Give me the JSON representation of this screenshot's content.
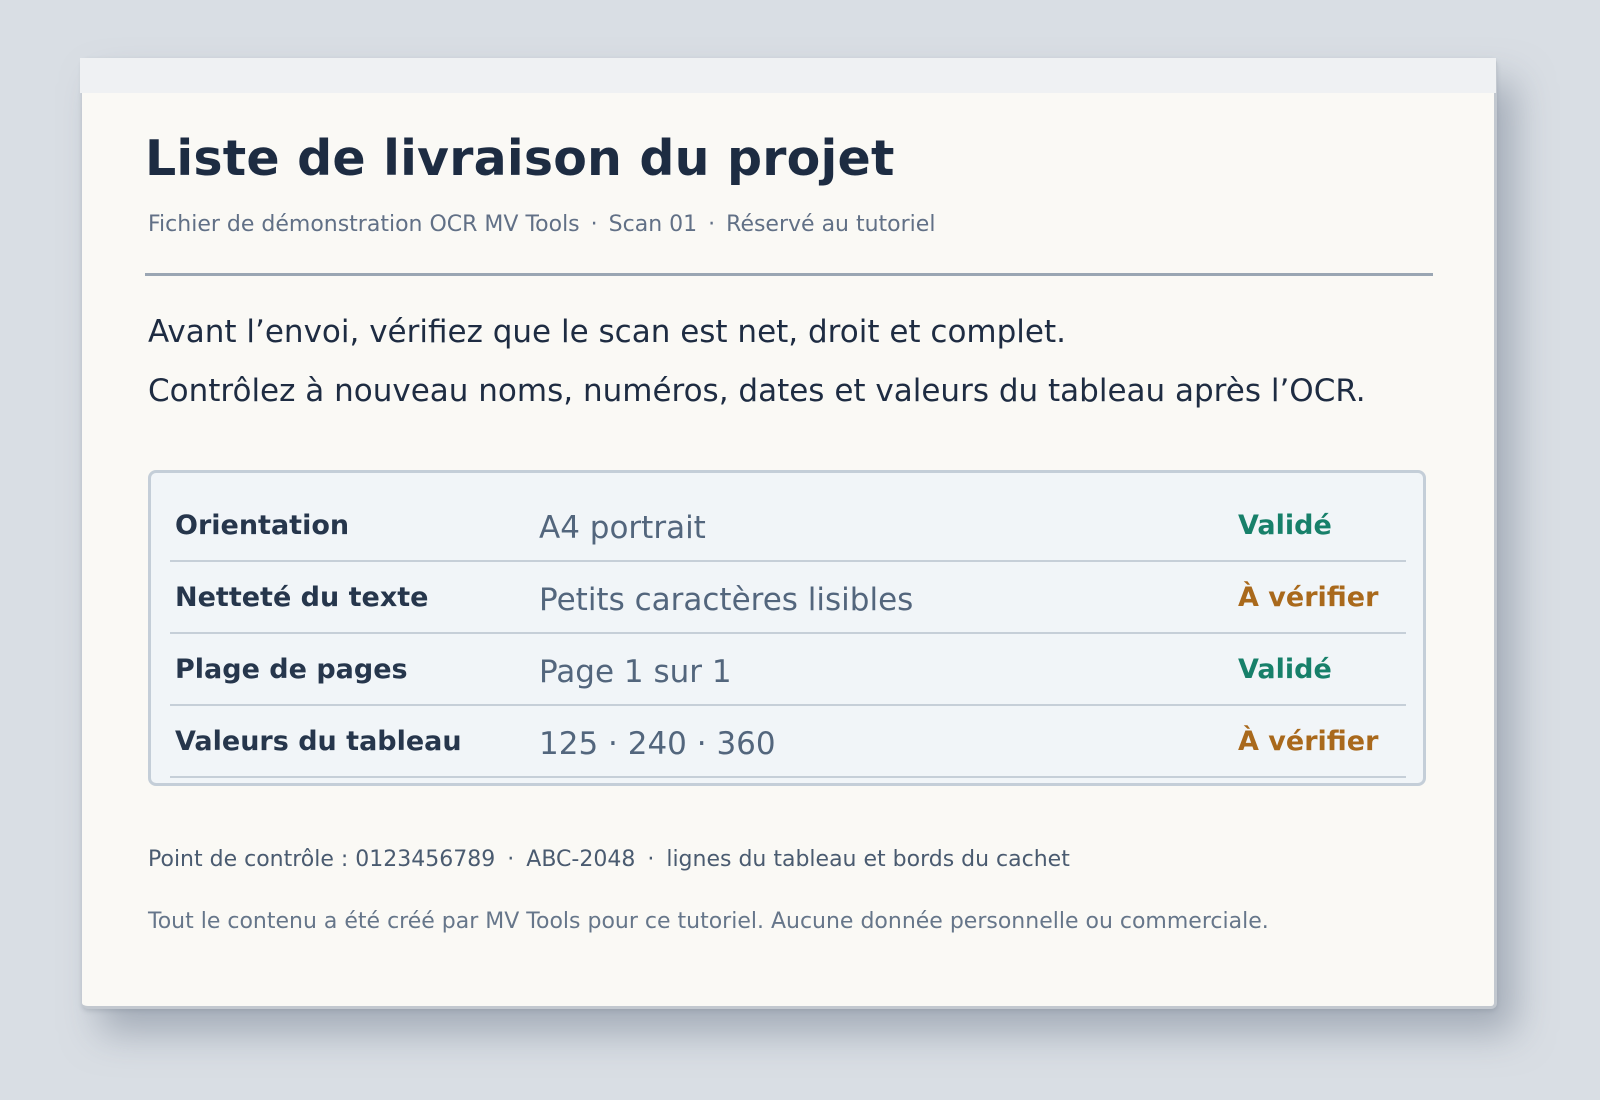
{
  "document": {
    "title": "Liste de livraison du projet",
    "meta": {
      "source": "Fichier de démonstration OCR MV Tools",
      "scan": "Scan 01",
      "usage": "Réservé au tutoriel",
      "separator": "·"
    },
    "intro": [
      "Avant l’envoi, vérifiez que le scan est net, droit et complet.",
      "Contrôlez à nouveau noms, numéros, dates et valeurs du tableau après l’OCR."
    ],
    "checklist": {
      "rows": [
        {
          "label": "Orientation",
          "value": "A4 portrait",
          "status": "Validé",
          "status_kind": "ok"
        },
        {
          "label": "Netteté du texte",
          "value": "Petits caractères lisibles",
          "status": "À vérifier",
          "status_kind": "check"
        },
        {
          "label": "Plage de pages",
          "value": "Page 1 sur 1",
          "status": "Validé",
          "status_kind": "ok"
        },
        {
          "label": "Valeurs du tableau",
          "value": "125 · 240 · 360",
          "status": "À vérifier",
          "status_kind": "check"
        }
      ]
    },
    "footer": {
      "checkpoint": "Point de contrôle : 0123456789",
      "reference": "ABC-2048",
      "scope": "lignes du tableau et bords du cachet",
      "separator": "·",
      "disclaimer": "Tout le contenu a été créé par MV Tools pour ce tutoriel. Aucune donnée personnelle ou commerciale."
    }
  },
  "colors": {
    "background": "#d9dee4",
    "paper": "#faf9f5",
    "title": "#1d2c42",
    "status_ok": "#17806a",
    "status_check": "#a9691c"
  }
}
